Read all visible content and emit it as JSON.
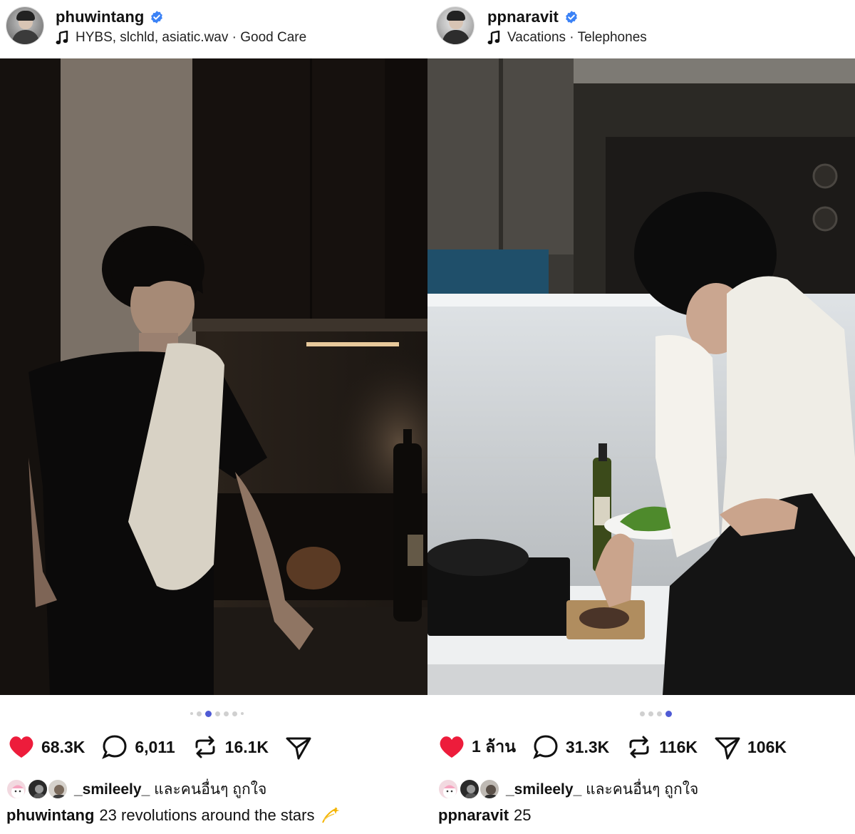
{
  "posts": [
    {
      "username": "phuwintang",
      "music": "HYBS, slchld, asiatic.wav · Good Care",
      "stats": {
        "likes": "68.3K",
        "comments": "6,011",
        "reposts": "16.1K"
      },
      "carousel": {
        "total": 7,
        "active_index": 2
      },
      "liked_by": {
        "user": "_smileely_",
        "suffix": "และคนอื่นๆ ถูกใจ"
      },
      "caption": {
        "user": "phuwintang",
        "text": "23 revolutions around the stars"
      },
      "icons": [
        "verified-icon",
        "music-note-icon",
        "heart-icon",
        "comment-icon",
        "repost-icon",
        "share-icon",
        "dizzy-sparkle-icon"
      ]
    },
    {
      "username": "ppnaravit",
      "music": "Vacations · Telephones",
      "stats": {
        "likes": "1 ล้าน",
        "comments": "31.3K",
        "reposts": "116K",
        "shares": "106K"
      },
      "carousel": {
        "total": 4,
        "active_index": 3
      },
      "liked_by": {
        "user": "_smileely_",
        "suffix": "และคนอื่นๆ ถูกใจ"
      },
      "caption": {
        "user": "ppnaravit",
        "text": "25"
      },
      "icons": [
        "verified-icon",
        "music-note-icon",
        "heart-icon",
        "comment-icon",
        "repost-icon",
        "share-icon"
      ]
    }
  ],
  "colors": {
    "heart": "#ed1c3b",
    "verified": "#3b82f6",
    "active_dot": "#4f5bd5",
    "inactive_dot": "#d0d0d0"
  }
}
